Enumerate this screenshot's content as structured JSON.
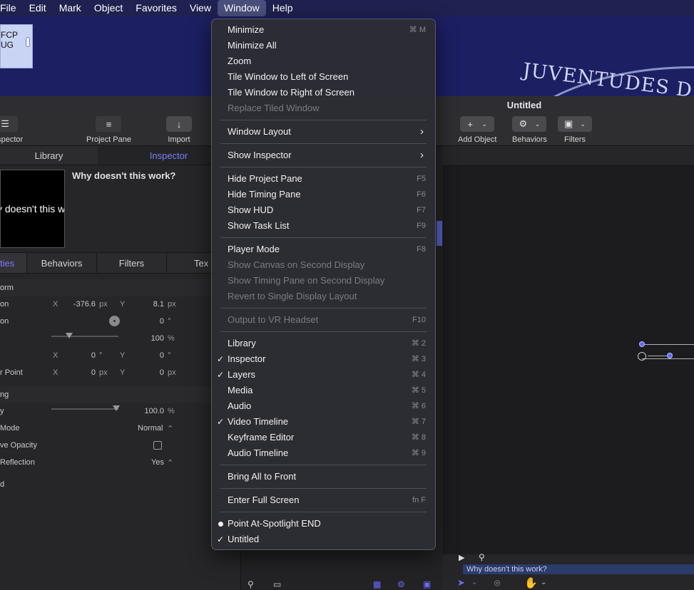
{
  "menubar": {
    "items": [
      "File",
      "Edit",
      "Mark",
      "Object",
      "Favorites",
      "View",
      "Window",
      "Help"
    ],
    "active": "Window"
  },
  "desktop": {
    "icon_line1": "FCP",
    "icon_line2": "UG",
    "wallpaper_text": "JUVENTUDES DE LA ON"
  },
  "window": {
    "title": "Untitled",
    "toolbar": {
      "inspector_label": "nspector",
      "project_pane_label": "Project Pane",
      "import_label": "Import",
      "add_object_label": "Add Object",
      "behaviors_label": "Behaviors",
      "filters_label": "Filters"
    },
    "left_tabs": {
      "library": "Library",
      "inspector": "Inspector"
    },
    "preview": {
      "text": "Why doesn't this work?",
      "title": "Why doesn't this work?"
    },
    "inspector_tabs": [
      "ties",
      "Behaviors",
      "Filters",
      "Tex"
    ],
    "transform": {
      "section": "orm",
      "position": {
        "label": "on",
        "x_label": "X",
        "x": "-376.6",
        "x_unit": "px",
        "y_label": "Y",
        "y": "8.1",
        "y_unit": "px"
      },
      "rotation": {
        "label": "on",
        "value": "0",
        "unit": "°"
      },
      "scale": {
        "value": "100",
        "unit": "%"
      },
      "shear": {
        "x_label": "X",
        "x": "0",
        "x_unit": "°",
        "y_label": "Y",
        "y": "0",
        "y_unit": "°"
      },
      "anchor": {
        "label": "r Point",
        "x_label": "X",
        "x": "0",
        "x_unit": "px",
        "y_label": "Y",
        "y": "0",
        "y_unit": "px"
      }
    },
    "blending": {
      "section": "ng",
      "opacity": {
        "label": "y",
        "value": "100.0",
        "unit": "%"
      },
      "blend_mode": {
        "label": "Mode",
        "value": "Normal"
      },
      "preserve_opacity": {
        "label": "ve Opacity",
        "checked": false
      },
      "cast_reflection": {
        "label": "Reflection",
        "value": "Yes"
      }
    },
    "lighting_section": "d",
    "timeline": {
      "bar_label": "Why doesn't this work?"
    }
  },
  "window_menu": {
    "items": [
      {
        "label": "Minimize",
        "shortcut": "⌘ M"
      },
      {
        "label": "Minimize All"
      },
      {
        "label": "Zoom"
      },
      {
        "label": "Tile Window to Left of Screen"
      },
      {
        "label": "Tile Window to Right of Screen"
      },
      {
        "label": "Replace Tiled Window",
        "disabled": true
      },
      {
        "sep": true
      },
      {
        "label": "Window Layout",
        "submenu": true
      },
      {
        "sep": true
      },
      {
        "label": "Show Inspector",
        "submenu": true
      },
      {
        "sep": true
      },
      {
        "label": "Hide Project Pane",
        "shortcut": "F5"
      },
      {
        "label": "Hide Timing Pane",
        "shortcut": "F6"
      },
      {
        "label": "Show HUD",
        "shortcut": "F7"
      },
      {
        "label": "Show Task List",
        "shortcut": "F9"
      },
      {
        "sep": true
      },
      {
        "label": "Player Mode",
        "shortcut": "F8"
      },
      {
        "label": "Show Canvas on Second Display",
        "disabled": true
      },
      {
        "label": "Show Timing Pane on Second Display",
        "disabled": true
      },
      {
        "label": "Revert to Single Display Layout",
        "disabled": true
      },
      {
        "sep": true
      },
      {
        "label": "Output to VR Headset",
        "shortcut": "F10",
        "disabled": true
      },
      {
        "sep": true
      },
      {
        "label": "Library",
        "shortcut": "⌘ 2"
      },
      {
        "label": "Inspector",
        "shortcut": "⌘ 3",
        "checked": true
      },
      {
        "label": "Layers",
        "shortcut": "⌘ 4",
        "checked": true
      },
      {
        "label": "Media",
        "shortcut": "⌘ 5"
      },
      {
        "label": "Audio",
        "shortcut": "⌘ 6"
      },
      {
        "label": "Video Timeline",
        "shortcut": "⌘ 7",
        "checked": true
      },
      {
        "label": "Keyframe Editor",
        "shortcut": "⌘ 8"
      },
      {
        "label": "Audio Timeline",
        "shortcut": "⌘ 9"
      },
      {
        "sep": true
      },
      {
        "label": "Bring All to Front"
      },
      {
        "sep": true
      },
      {
        "label": "Enter Full Screen",
        "shortcut": "fn F"
      },
      {
        "sep": true
      },
      {
        "label": "Point At-Spotlight END",
        "bullet": true
      },
      {
        "label": "Untitled",
        "checked": true
      }
    ]
  }
}
